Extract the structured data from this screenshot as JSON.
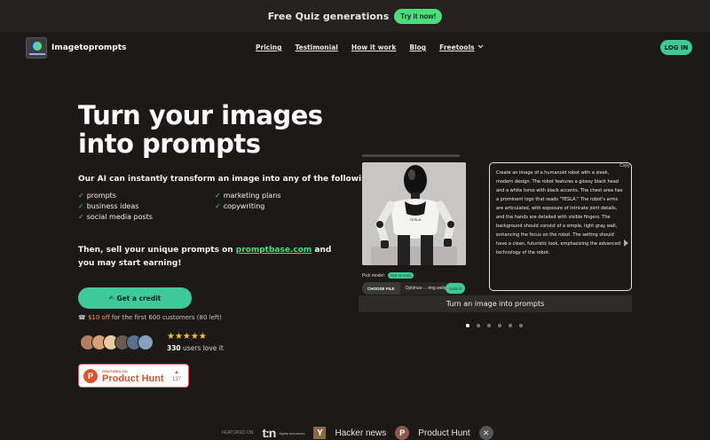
{
  "banner": {
    "text": "Free Quiz generations",
    "button": "Try it now!"
  },
  "nav": {
    "brand": "Imagetoprompts",
    "links": [
      "Pricing",
      "Testimonial",
      "How it work",
      "Blog",
      "Freetools"
    ],
    "login": "LOG IN"
  },
  "hero": {
    "title": "Turn your images into prompts",
    "subtitle": "Our AI can instantly transform an image into any of the following:",
    "features_left": [
      "prompts",
      "business ideas",
      "social media posts"
    ],
    "features_right": [
      "marketing plans",
      "copywriting"
    ],
    "sell_prefix": "Then, sell your unique prompts on ",
    "sell_link": "promptbase.com",
    "sell_suffix": " and you may start earning!",
    "cta": "Get a credit",
    "cta_icon": "✍",
    "offer_icon": "☎",
    "offer_highlight": "$10 off",
    "offer_rest": " for the first 600 customers (80 left)",
    "stars": "★★★★★",
    "users_count": "330",
    "users_text": " users love it"
  },
  "producthunt": {
    "small": "FEATURED ON",
    "big": "Product Hunt",
    "upvotes": "137"
  },
  "demo": {
    "description": "Create an image of a humanoid robot with a sleek, modern design. The robot features a glossy black head and a white torso with black accents. The chest area has a prominent logo that reads \"TESLA.\" The robot's arms are articulated, with exposure of intricate joint details, and the hands are detailed with visible fingers. The background should consist of a simple, light gray wall, enhancing the focus on the robot. The setting should have a clean, futuristic look, emphasizing the advanced technology of the robot.",
    "copy": "Copy",
    "pick_label": "Pick model:",
    "pick_value": "Opt-4o-mini",
    "choose_file": "CHOOSE FILE",
    "filename": "Optimus-...-img.webp",
    "submit": "Submit",
    "caption": "Turn an image into prompts",
    "slides": 6,
    "active_slide": 0
  },
  "featured": {
    "label": "FEATURED ON",
    "tn": "t:n",
    "tn_sub": "digital\nresources",
    "hn": "Hacker news",
    "ph": "Product Hunt"
  },
  "colors": {
    "accent": "#3ec99a",
    "background": "#1c1918",
    "banner": "#262220"
  }
}
